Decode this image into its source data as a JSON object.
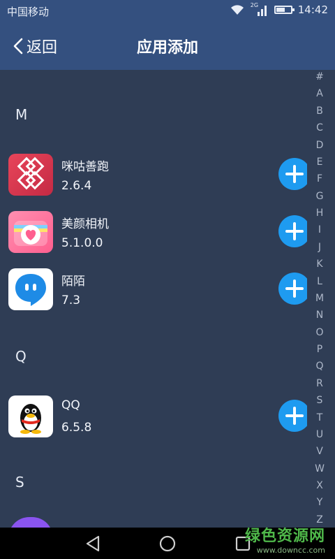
{
  "status": {
    "carrier": "中国移动",
    "network": "2G",
    "time": "14:42"
  },
  "header": {
    "back_label": "返回",
    "title": "应用添加"
  },
  "sections": [
    {
      "letter": "M"
    },
    {
      "letter": "Q"
    },
    {
      "letter": "S"
    }
  ],
  "apps": [
    {
      "name": "咪咕善跑",
      "version": "2.6.4",
      "icon": "migu-run-icon"
    },
    {
      "name": "美颜相机",
      "version": "5.1.0.0",
      "icon": "beauty-camera-icon"
    },
    {
      "name": "陌陌",
      "version": "7.3",
      "icon": "momo-icon"
    },
    {
      "name": "QQ",
      "version": "6.5.8",
      "icon": "qq-penguin-icon"
    }
  ],
  "index_letters": [
    "#",
    "A",
    "B",
    "C",
    "D",
    "E",
    "F",
    "G",
    "H",
    "I",
    "J",
    "K",
    "L",
    "M",
    "N",
    "O",
    "P",
    "Q",
    "R",
    "S",
    "T",
    "U",
    "V",
    "W",
    "X",
    "Y",
    "Z"
  ],
  "watermark": {
    "main": "绿色资源网",
    "url": "www.downcc.com"
  },
  "colors": {
    "header": "#34507f",
    "background": "#2f3d55",
    "accent": "#1e9bf0"
  }
}
